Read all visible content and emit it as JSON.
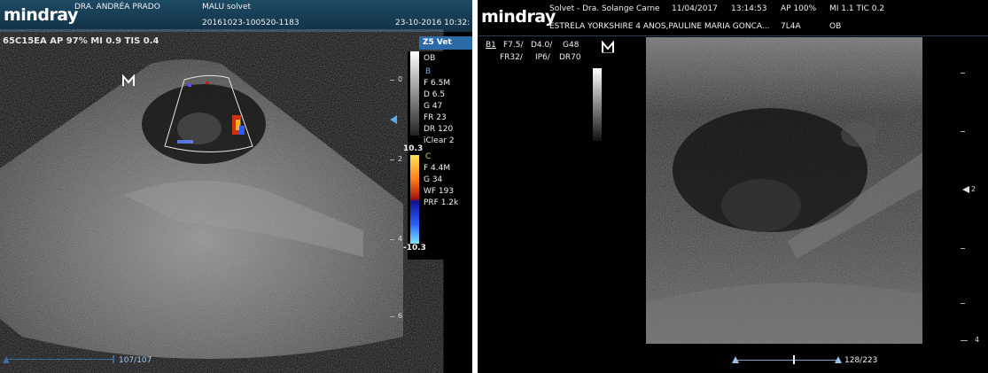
{
  "left": {
    "logo": "mindray",
    "doctor": "DRA. ANDRÉA PRADO",
    "patient": "MALU solvet",
    "exam_id": "20161023-100520-1183",
    "date": "23-10-2016 10:32:",
    "probe_line": "65C15EA  AP 97%  MI 0.9  TIS 0.4",
    "preset": "Z5 Vet",
    "ob": "OB",
    "b_mode": {
      "label": "B",
      "items": [
        "F 6.5M",
        "D 6.5",
        "G 47",
        "FR 23",
        "DR 120",
        "iClear 2"
      ]
    },
    "color_scale_top": "10.3",
    "color_scale_bottom": "-10.3",
    "c_mode": {
      "label": "C",
      "items": [
        "F 4.4M",
        "G 34",
        "WF 193",
        "PRF 1.2k"
      ]
    },
    "depth_marks": [
      "0",
      "2",
      "4",
      "6"
    ],
    "cine": "107/107"
  },
  "right": {
    "logo": "mindray",
    "clinic": "Solvet - Dra. Solange Carne",
    "date": "11/04/2017",
    "time": "13:14:53",
    "ap": "AP  100%",
    "mi_tic": "MI 1.1  TIC 0.2",
    "patient": "ESTRELA YORKSHIRE 4 ANOS,PAULINE MARIA GONCA...",
    "probe": "7L4A",
    "ob": "OB",
    "params": {
      "b1": "B1",
      "f": "F7.5/",
      "d": "D4.0/",
      "g": "G48",
      "fr": "FR32/",
      "ip": "IP6/",
      "dr": "DR70"
    },
    "depth_marks": [
      "2",
      "4"
    ],
    "cine": "128/223"
  },
  "colors": {
    "header_blue": "#1d4a64",
    "accent_blue": "#2c6aa8",
    "text": "#f0f0f0"
  }
}
